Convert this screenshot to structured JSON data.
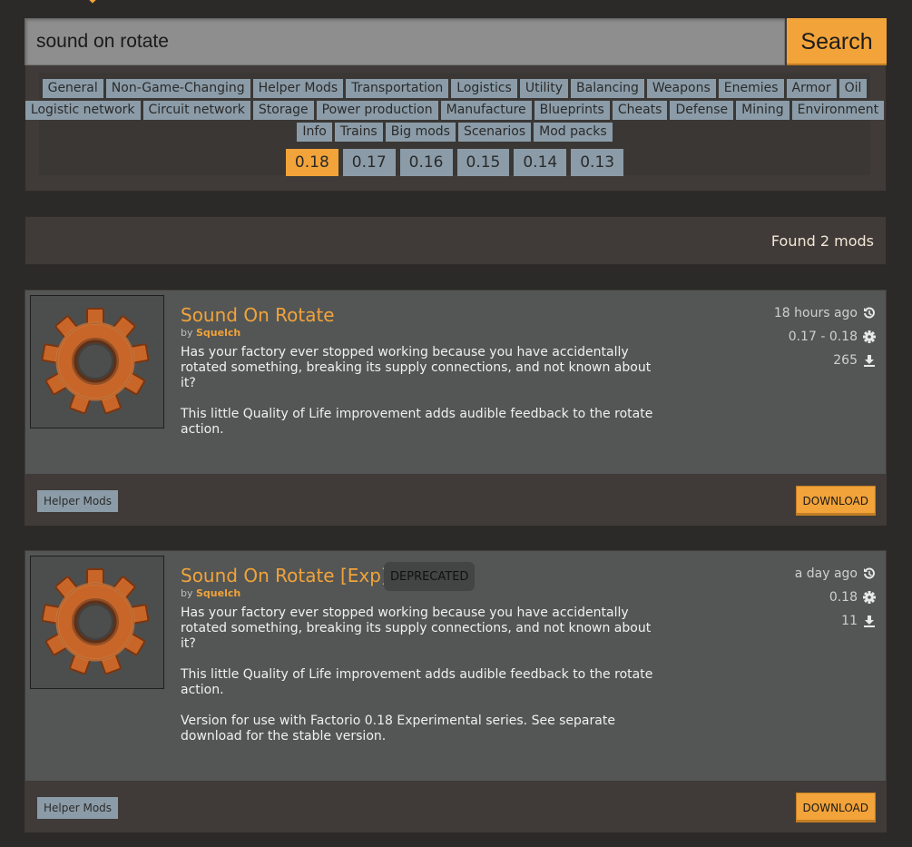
{
  "search": {
    "value": "sound on rotate",
    "button_label": "Search"
  },
  "tags": [
    [
      "General",
      "Non-Game-Changing",
      "Helper Mods",
      "Transportation",
      "Logistics",
      "Utility",
      "Balancing",
      "Weapons",
      "Enemies",
      "Armor",
      "Oil"
    ],
    [
      "Logistic network",
      "Circuit network",
      "Storage",
      "Power production",
      "Manufacture",
      "Blueprints",
      "Cheats",
      "Defense",
      "Mining",
      "Environment"
    ],
    [
      "Info",
      "Trains",
      "Big mods",
      "Scenarios",
      "Mod packs"
    ]
  ],
  "versions": [
    "0.18",
    "0.17",
    "0.16",
    "0.15",
    "0.14",
    "0.13"
  ],
  "selected_version": "0.18",
  "results": {
    "text": "Found 2 mods"
  },
  "mods": [
    {
      "title": "Sound On Rotate",
      "by": "by",
      "author": "Squelch",
      "summary": [
        "Has your factory ever stopped working because you have accidentally rotated something, breaking its supply connections, and not known about it?",
        "This little Quality of Life improvement adds audible feedback to the rotate action."
      ],
      "updated": "18 hours ago",
      "versions": "0.17 - 0.18",
      "downloads": "265",
      "tag": "Helper Mods",
      "download_label": "DOWNLOAD"
    },
    {
      "title": "Sound On Rotate [Exp]",
      "badge": "DEPRECATED",
      "by": "by",
      "author": "Squelch",
      "summary": [
        "Has your factory ever stopped working because you have accidentally rotated something, breaking its supply connections, and not known about it?",
        "This little Quality of Life improvement adds audible feedback to the rotate action.",
        "Version for use with Factorio 0.18 Experimental series. See separate download for the stable version."
      ],
      "updated": "a day ago",
      "versions": "0.18",
      "downloads": "11",
      "tag": "Helper Mods",
      "download_label": "DOWNLOAD"
    }
  ],
  "colors": {
    "accent": "#f2a33a",
    "tag": "#8b9ca8",
    "panel": "#403b38",
    "card": "#535655",
    "background": "#2b2a29"
  },
  "icons": {
    "updated": "history-icon",
    "versions": "gear-icon",
    "downloads": "download-icon",
    "thumbnail": "gear-thumbnail"
  }
}
